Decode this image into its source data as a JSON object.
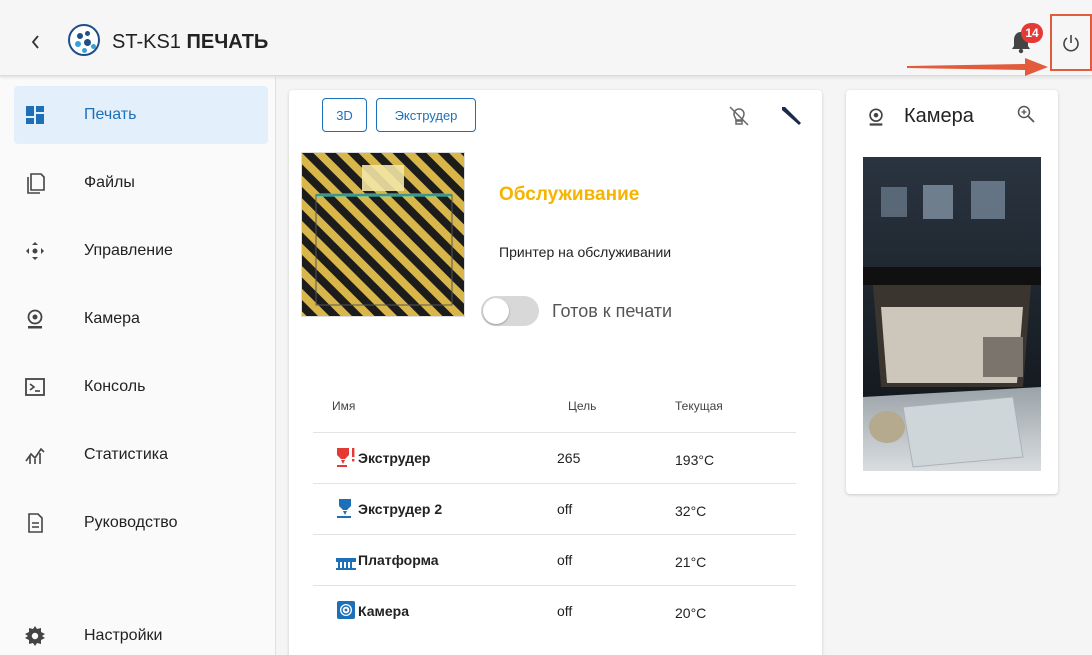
{
  "header": {
    "brand_prefix": "ST-KS1",
    "brand_bold": "ПЕЧАТЬ",
    "notification_count": "14"
  },
  "sidebar": {
    "items": [
      {
        "label": "Печать",
        "icon": "dashboard-icon",
        "active": true
      },
      {
        "label": "Файлы",
        "icon": "files-icon"
      },
      {
        "label": "Управление",
        "icon": "control-icon"
      },
      {
        "label": "Камера",
        "icon": "webcam-icon"
      },
      {
        "label": "Консоль",
        "icon": "console-icon"
      },
      {
        "label": "Статистика",
        "icon": "statistics-icon"
      },
      {
        "label": "Руководство",
        "icon": "document-icon"
      },
      {
        "label": "Настройки",
        "icon": "settings-gear-icon"
      }
    ]
  },
  "main": {
    "tabs": [
      "3D",
      "Экструдер"
    ],
    "status_title": "Обслуживание",
    "status_description": "Принтер на обслуживании",
    "ready_toggle_label": "Готов к печати",
    "ready_toggle_on": false,
    "table": {
      "headers": [
        "Имя",
        "Цель",
        "Текущая"
      ],
      "rows": [
        {
          "name": "Экструдер",
          "target": "265",
          "current": "193°C",
          "icon": "extruder-warning-icon",
          "color": "#e53935"
        },
        {
          "name": "Экструдер 2",
          "target": "off",
          "current": "32°C",
          "icon": "extruder-icon",
          "color": "#1d6fb8"
        },
        {
          "name": "Платформа",
          "target": "off",
          "current": "21°C",
          "icon": "heated-bed-icon",
          "color": "#1d6fb8"
        },
        {
          "name": "Камера",
          "target": "off",
          "current": "20°C",
          "icon": "chamber-fan-icon",
          "color": "#1d6fb8"
        }
      ]
    }
  },
  "camera": {
    "title": "Камера"
  },
  "colors": {
    "accent": "#1d6fb8",
    "warning": "#f4b400",
    "badge": "#e53935",
    "annotation": "#e15b3c"
  }
}
